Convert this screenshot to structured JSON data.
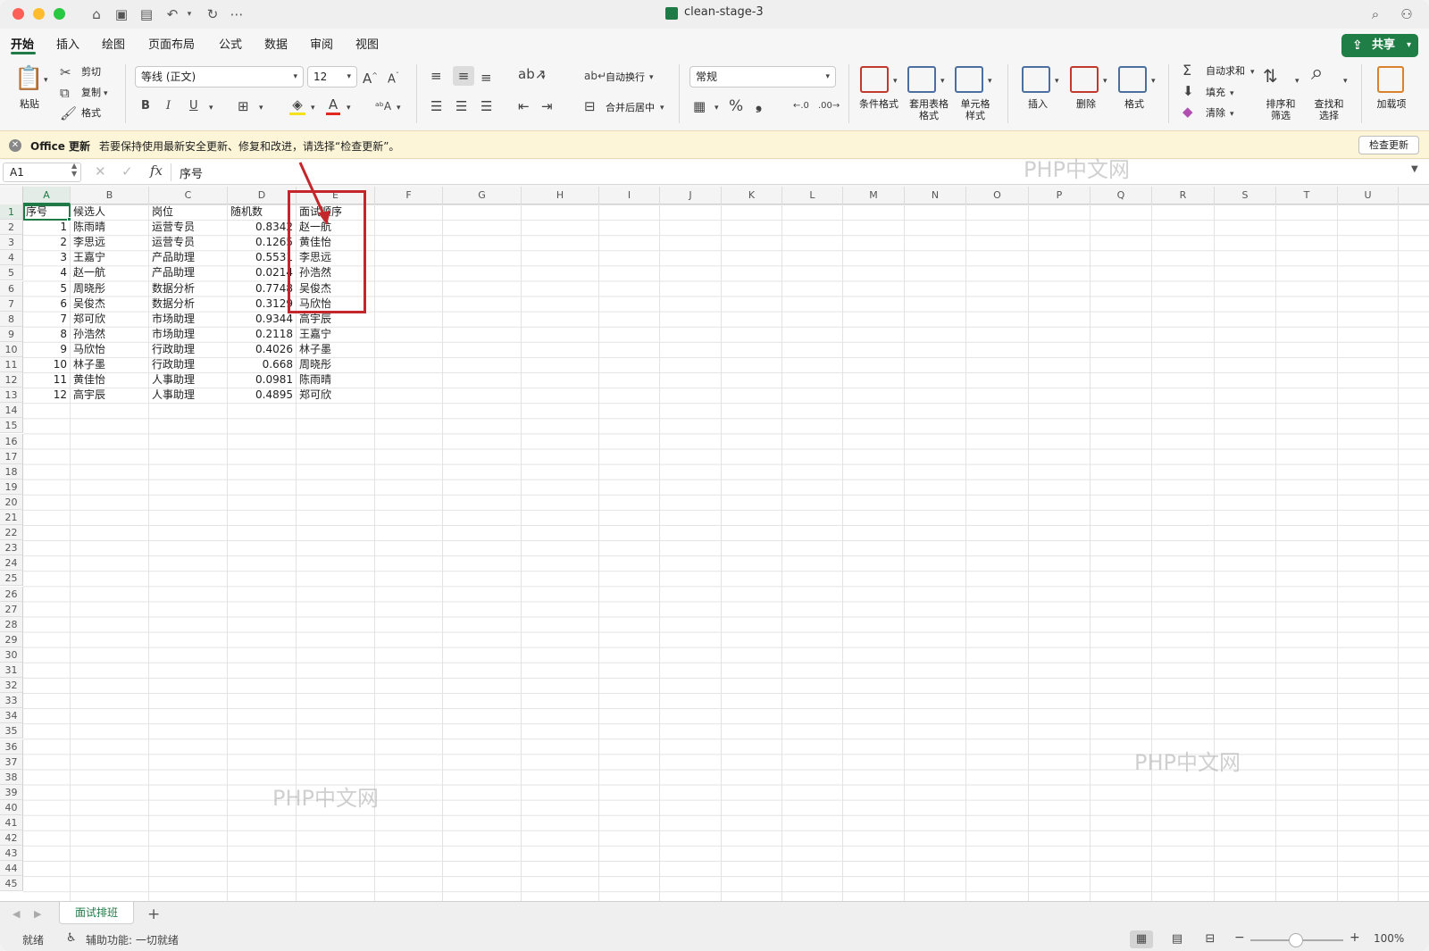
{
  "window": {
    "title": "clean-stage-3",
    "traffic_colors": [
      "#fe5f57",
      "#febc2e",
      "#28c840"
    ]
  },
  "ribbon_tabs": [
    "开始",
    "插入",
    "绘图",
    "页面布局",
    "公式",
    "数据",
    "审阅",
    "视图"
  ],
  "active_tab": "开始",
  "share_label": "共享",
  "ribbon": {
    "paste": "粘贴",
    "cut": "剪切",
    "copy": "复制",
    "format_painter": "格式",
    "font_name": "等线 (正文)",
    "font_size": "12",
    "bold": "B",
    "italic": "I",
    "underline": "U",
    "wrap_text": "自动换行",
    "merge_center": "合并后居中",
    "number_format": "常规",
    "percent": "%",
    "comma": "❟",
    "conditional_format": [
      "条件格式"
    ],
    "table_format": [
      "套用表格",
      "格式"
    ],
    "cell_styles": [
      "单元格",
      "样式"
    ],
    "insert": "插入",
    "delete": "删除",
    "format": "格式",
    "autosum": "自动求和",
    "fill": "填充",
    "clear": "清除",
    "sort_filter": [
      "排序和",
      "筛选"
    ],
    "find_select": [
      "查找和",
      "选择"
    ],
    "addins": "加载项"
  },
  "update_bar": {
    "title": "Office 更新",
    "message": "若要保持使用最新安全更新、修复和改进，请选择“检查更新”。",
    "button": "检查更新"
  },
  "formula_bar": {
    "name_box": "A1",
    "fx": "fx",
    "content": "序号"
  },
  "columns": [
    "A",
    "B",
    "C",
    "D",
    "E",
    "F",
    "G",
    "H",
    "I",
    "J",
    "K",
    "L",
    "M",
    "N",
    "O",
    "P",
    "Q",
    "R",
    "S",
    "T",
    "U"
  ],
  "row_count": 45,
  "table": {
    "headers": [
      "序号",
      "候选人",
      "岗位",
      "随机数",
      "面试顺序"
    ],
    "rows": [
      [
        "1",
        "陈雨晴",
        "运营专员",
        "0.8342",
        "赵一航"
      ],
      [
        "2",
        "李思远",
        "运营专员",
        "0.1265",
        "黄佳怡"
      ],
      [
        "3",
        "王嘉宁",
        "产品助理",
        "0.5531",
        "李思远"
      ],
      [
        "4",
        "赵一航",
        "产品助理",
        "0.0214",
        "孙浩然"
      ],
      [
        "5",
        "周晓彤",
        "数据分析",
        "0.7748",
        "吴俊杰"
      ],
      [
        "6",
        "吴俊杰",
        "数据分析",
        "0.3129",
        "马欣怡"
      ],
      [
        "7",
        "郑可欣",
        "市场助理",
        "0.9344",
        "高宇辰"
      ],
      [
        "8",
        "孙浩然",
        "市场助理",
        "0.2118",
        "王嘉宁"
      ],
      [
        "9",
        "马欣怡",
        "行政助理",
        "0.4026",
        "林子墨"
      ],
      [
        "10",
        "林子墨",
        "行政助理",
        "0.668",
        "周晓彤"
      ],
      [
        "11",
        "黄佳怡",
        "人事助理",
        "0.0981",
        "陈雨晴"
      ],
      [
        "12",
        "高宇辰",
        "人事助理",
        "0.4895",
        "郑可欣"
      ]
    ]
  },
  "watermark": "PHP中文网",
  "sheet_tab": "面试排班",
  "status": {
    "ready": "就绪",
    "accessibility": "辅助功能: 一切就绪",
    "zoom": "100%"
  }
}
